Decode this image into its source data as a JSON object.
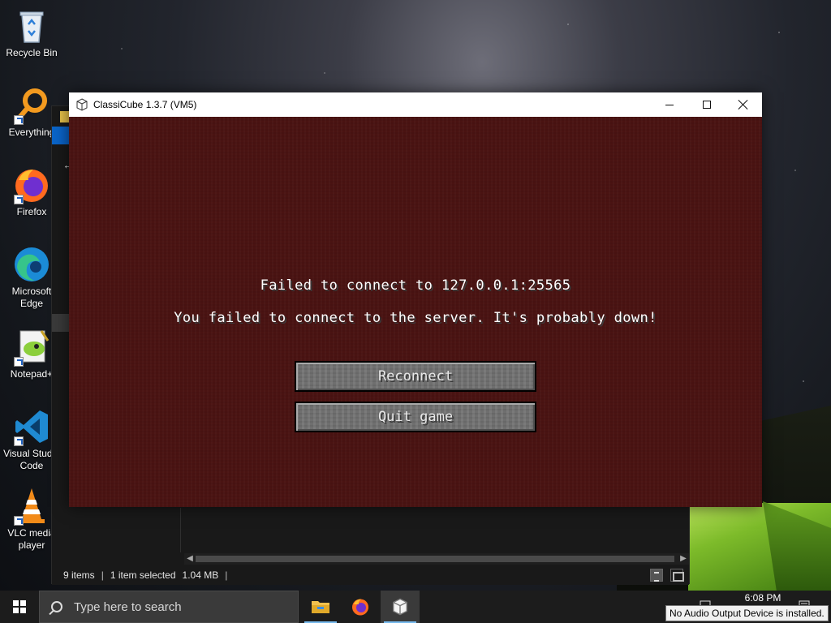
{
  "desktop": {
    "icons": [
      {
        "label": "Recycle Bin",
        "icon": "recycle-bin-icon"
      },
      {
        "label": "Everything",
        "icon": "everything-icon"
      },
      {
        "label": "Firefox",
        "icon": "firefox-icon"
      },
      {
        "label": "Microsoft Edge",
        "icon": "edge-icon"
      },
      {
        "label": "Notepad+",
        "icon": "notepad-plus-icon"
      },
      {
        "label": "Visual Studio Code",
        "icon": "vscode-icon"
      },
      {
        "label": "VLC media player",
        "icon": "vlc-icon"
      }
    ]
  },
  "explorer": {
    "status": {
      "items": "9 items",
      "selected": "1 item selected",
      "size": "1.04 MB"
    }
  },
  "classicube": {
    "title": "ClassiCube 1.3.7 (VM5)",
    "error_title": "Failed to connect to 127.0.0.1:25565",
    "error_message": "You failed to connect to the server. It's probably down!",
    "buttons": {
      "reconnect": "Reconnect",
      "quit": "Quit game"
    }
  },
  "taskbar": {
    "search_placeholder": "Type here to search",
    "clock": "6:08 PM",
    "tooltip": "No Audio Output Device is installed."
  },
  "colors": {
    "game_background": "#4a1312",
    "button_gray": "#6f6f6f",
    "taskbar": "#1c1c1c",
    "accent": "#76b9ed"
  }
}
